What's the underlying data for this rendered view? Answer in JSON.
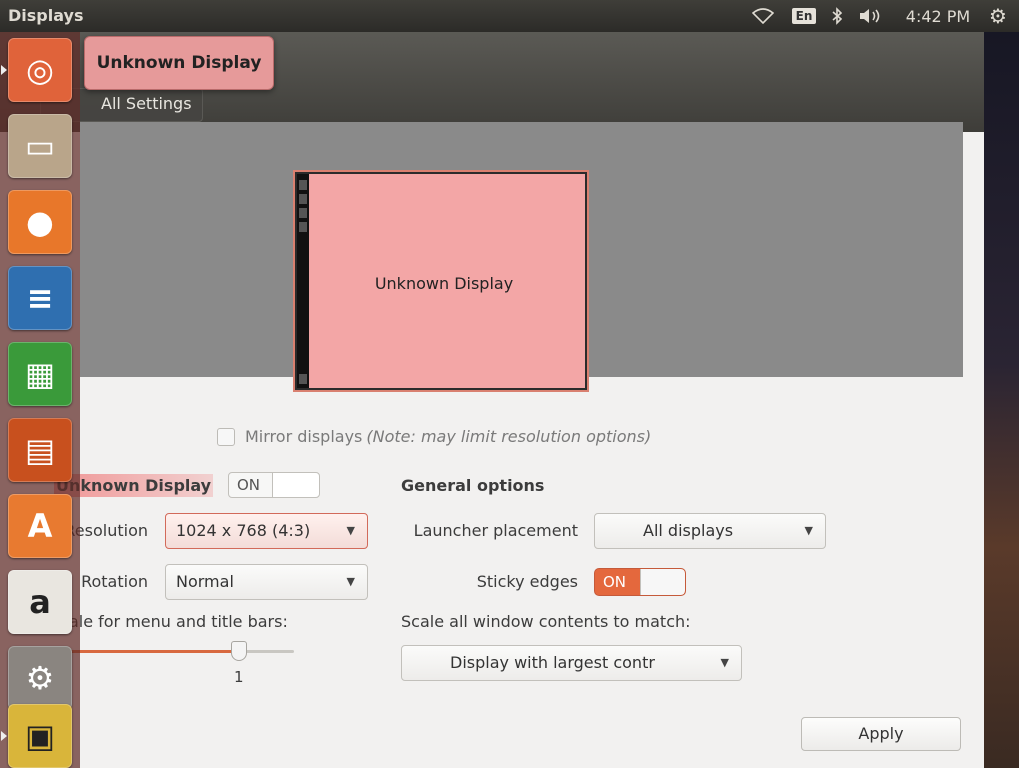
{
  "top_panel": {
    "window_title": "Displays",
    "keyboard_layout": "En",
    "clock": "4:42 PM"
  },
  "titlebar": {
    "all_settings_label": "All Settings",
    "tooltip": "Unknown Display"
  },
  "arrangement": {
    "monitor_label": "Unknown Display"
  },
  "mirror": {
    "label": "Mirror displays",
    "note": "(Note: may limit resolution options)"
  },
  "display_section": {
    "heading": "Unknown Display",
    "toggle_label": "ON",
    "resolution_label": "Resolution",
    "resolution_value": "1024 x 768 (4:3)",
    "rotation_label": "Rotation",
    "rotation_value": "Normal",
    "scale_label": "Scale for menu and title bars:",
    "scale_value": "1",
    "scale_fraction": 0.76
  },
  "general_section": {
    "heading": "General options",
    "launcher_placement_label": "Launcher placement",
    "launcher_placement_value": "All displays",
    "sticky_edges_label": "Sticky edges",
    "sticky_edges_state": "ON",
    "scale_all_label": "Scale all window contents to match:",
    "scale_all_value": "Display with largest contr"
  },
  "apply_label": "Apply",
  "launcher": {
    "items": [
      {
        "name": "ubuntu-dash-icon",
        "glyph": "◎",
        "color": "#e0633a"
      },
      {
        "name": "files-icon",
        "glyph": "▭",
        "color": "#b9a58a"
      },
      {
        "name": "firefox-icon",
        "glyph": "●",
        "color": "#e8772a"
      },
      {
        "name": "writer-icon",
        "glyph": "≡",
        "color": "#2f6fb0"
      },
      {
        "name": "calc-icon",
        "glyph": "▦",
        "color": "#3a9a3a"
      },
      {
        "name": "impress-icon",
        "glyph": "▤",
        "color": "#c8501e"
      },
      {
        "name": "software-center-icon",
        "glyph": "A",
        "color": "#e87a30"
      },
      {
        "name": "amazon-icon",
        "glyph": "a",
        "color": "#e9e6e0"
      },
      {
        "name": "system-settings-icon",
        "glyph": "⚙",
        "color": "#8a8580"
      },
      {
        "name": "displays-app-icon",
        "glyph": "▣",
        "color": "#d9b53a"
      }
    ]
  }
}
